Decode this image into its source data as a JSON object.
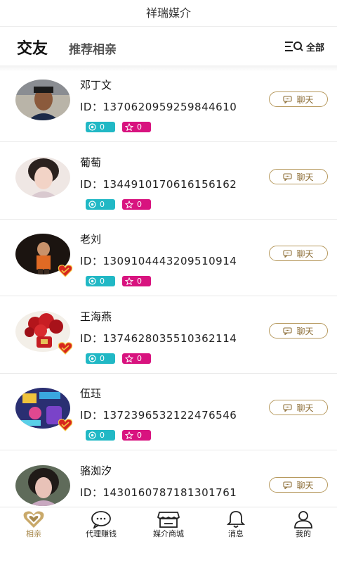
{
  "app_title": "祥瑞媒介",
  "tabs": {
    "primary": "交友",
    "secondary": "推荐相亲"
  },
  "filter": {
    "label": "全部",
    "icon": "filter-search-icon"
  },
  "colors": {
    "accent_gold": "#b79a5f",
    "teal": "#21b8c5",
    "pink": "#d8137f"
  },
  "members": [
    {
      "name": "邓丁文",
      "id": "ID：1370620959259844610",
      "stat_a": "0",
      "stat_b": "0",
      "chat": "聊天",
      "verified": false
    },
    {
      "name": "葡萄",
      "id": "ID：1344910170616156162",
      "stat_a": "0",
      "stat_b": "0",
      "chat": "聊天",
      "verified": false
    },
    {
      "name": "老刘",
      "id": "ID：1309104443209510914",
      "stat_a": "0",
      "stat_b": "0",
      "chat": "聊天",
      "verified": true
    },
    {
      "name": "王海燕",
      "id": "ID：1374628035510362114",
      "stat_a": "0",
      "stat_b": "0",
      "chat": "聊天",
      "verified": true
    },
    {
      "name": "伍珏",
      "id": "ID：1372396532122476546",
      "stat_a": "0",
      "stat_b": "0",
      "chat": "聊天",
      "verified": true
    },
    {
      "name": "骆洳汐",
      "id": "ID：1430160787181301761",
      "stat_a": "0",
      "stat_b": "0",
      "chat": "聊天",
      "verified": false
    }
  ],
  "bottom_nav": [
    {
      "label": "相亲",
      "icon": "heart-icon",
      "active": true
    },
    {
      "label": "代理赚钱",
      "icon": "chat-bubble-icon",
      "active": false
    },
    {
      "label": "媒介商城",
      "icon": "shop-icon",
      "active": false
    },
    {
      "label": "消息",
      "icon": "bell-icon",
      "active": false
    },
    {
      "label": "我的",
      "icon": "user-icon",
      "active": false
    }
  ]
}
